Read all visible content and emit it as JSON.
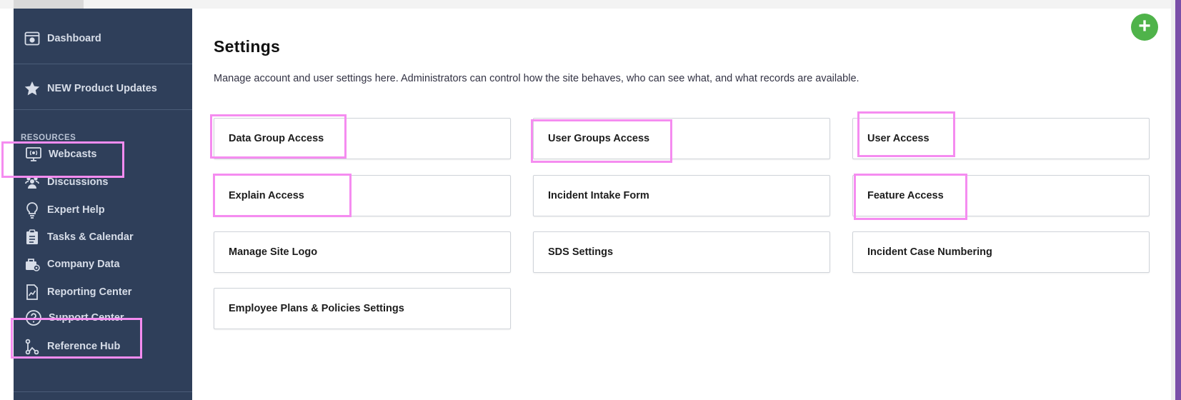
{
  "sidebar": {
    "dashboard": "Dashboard",
    "product_updates": "NEW Product Updates",
    "resources_label": "RESOURCES",
    "items": [
      {
        "label": "Webcasts",
        "icon": "webcast-icon"
      },
      {
        "label": "Discussions",
        "icon": "people-icon"
      },
      {
        "label": "Expert Help",
        "icon": "lightbulb-icon"
      },
      {
        "label": "Tasks & Calendar",
        "icon": "clipboard-icon"
      },
      {
        "label": "Company Data",
        "icon": "briefcase-icon"
      },
      {
        "label": "Reporting Center",
        "icon": "report-icon"
      },
      {
        "label": "Support Center",
        "icon": "question-icon"
      },
      {
        "label": "Reference Hub",
        "icon": "hub-icon"
      }
    ]
  },
  "main": {
    "title": "Settings",
    "description": "Manage account and user settings here. Administrators can control how the site behaves, who can see what, and what records are available.",
    "cards": [
      "Data Group Access",
      "User Groups Access",
      "User Access",
      "Explain Access",
      "Incident Intake Form",
      "Feature Access",
      "Manage Site Logo",
      "SDS Settings",
      "Incident Case Numbering",
      "Employee Plans & Policies Settings"
    ],
    "add_button": "+"
  },
  "colors": {
    "sidebar_bg": "#2f3f5a",
    "highlight": "#f58cf0",
    "add_button": "#4fb34a",
    "accent_bar": "#7a4fa8"
  }
}
